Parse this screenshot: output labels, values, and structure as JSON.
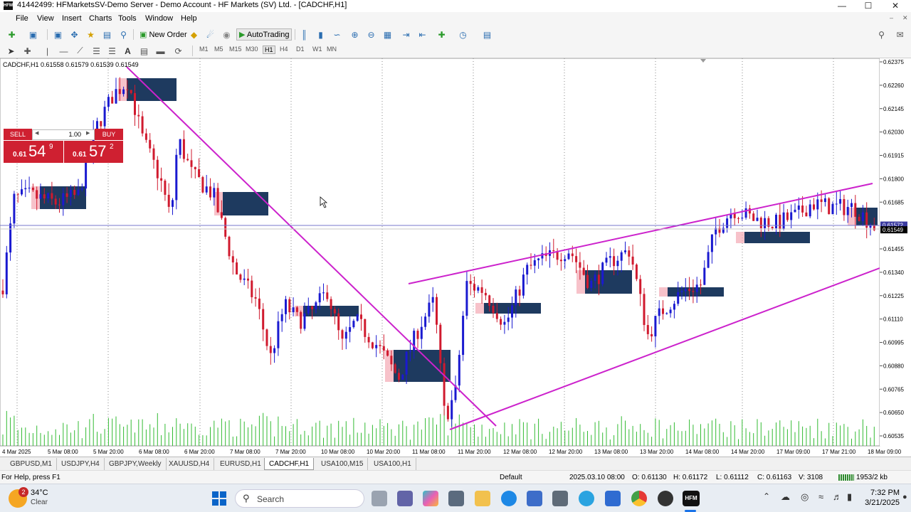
{
  "window": {
    "title": "41442499: HFMarketsSV-Demo Server - Demo Account - HF Markets (SV) Ltd. - [CADCHF,H1]",
    "logo": "HFM"
  },
  "menu": [
    "File",
    "View",
    "Insert",
    "Charts",
    "Tools",
    "Window",
    "Help"
  ],
  "toolbar": {
    "new_order": "New Order",
    "autotrading": "AutoTrading",
    "timeframes": [
      "M1",
      "M5",
      "M15",
      "M30",
      "H1",
      "H4",
      "D1",
      "W1",
      "MN"
    ]
  },
  "chart": {
    "symbol_info": "CADCHF,H1  0.61558 0.61579 0.61539 0.61549",
    "trade_panel": {
      "sell_label": "SELL",
      "buy_label": "BUY",
      "lot": "1.00",
      "sell_price_small": "0.61",
      "sell_price_big": "54",
      "sell_price_sup": "9",
      "buy_price_small": "0.61",
      "buy_price_big": "57",
      "buy_price_sup": "2"
    },
    "price_axis": [
      "0.62375",
      "0.62260",
      "0.62145",
      "0.62030",
      "0.61915",
      "0.61800",
      "0.61685",
      "0.61572",
      "0.61549",
      "0.61455",
      "0.61340",
      "0.61225",
      "0.61110",
      "0.60995",
      "0.60880",
      "0.60765",
      "0.60650",
      "0.60535"
    ],
    "time_axis": [
      "4 Mar 2025",
      "5 Mar 08:00",
      "5 Mar 20:00",
      "6 Mar 08:00",
      "6 Mar 20:00",
      "7 Mar 08:00",
      "7 Mar 20:00",
      "10 Mar 08:00",
      "10 Mar 20:00",
      "11 Mar 08:00",
      "11 Mar 20:00",
      "12 Mar 08:00",
      "12 Mar 20:00",
      "13 Mar 08:00",
      "13 Mar 20:00",
      "14 Mar 08:00",
      "14 Mar 20:00",
      "17 Mar 09:00",
      "17 Mar 21:00",
      "18 Mar 09:00"
    ],
    "ask_label": "0.61572",
    "bid_label": "0.61549",
    "colors": {
      "bull": "#1a1ad0",
      "bear": "#d01a2e",
      "trend": "#cc22cc",
      "zone": "#1e3a5f",
      "volume": "#33bb33"
    }
  },
  "tabs": [
    "GBPUSD,M1",
    "USDJPY,H4",
    "GBPJPY,Weekly",
    "XAUUSD,H4",
    "EURUSD,H1",
    "CADCHF,H1",
    "USA100,M15",
    "USA100,H1"
  ],
  "active_tab": "CADCHF,H1",
  "status": {
    "help": "For Help, press F1",
    "profile": "Default",
    "datetime": "2025.03.10 08:00",
    "open": "O: 0.61130",
    "high": "H: 0.61172",
    "low": "L: 0.61112",
    "close": "C: 0.61163",
    "volume": "V: 3108",
    "traffic": "1953/2 kb"
  },
  "taskbar": {
    "weather_temp": "34°C",
    "weather_text": "Clear",
    "weather_badge": "2",
    "search_placeholder": "Search",
    "time": "7:32 PM",
    "date": "3/21/2025"
  }
}
